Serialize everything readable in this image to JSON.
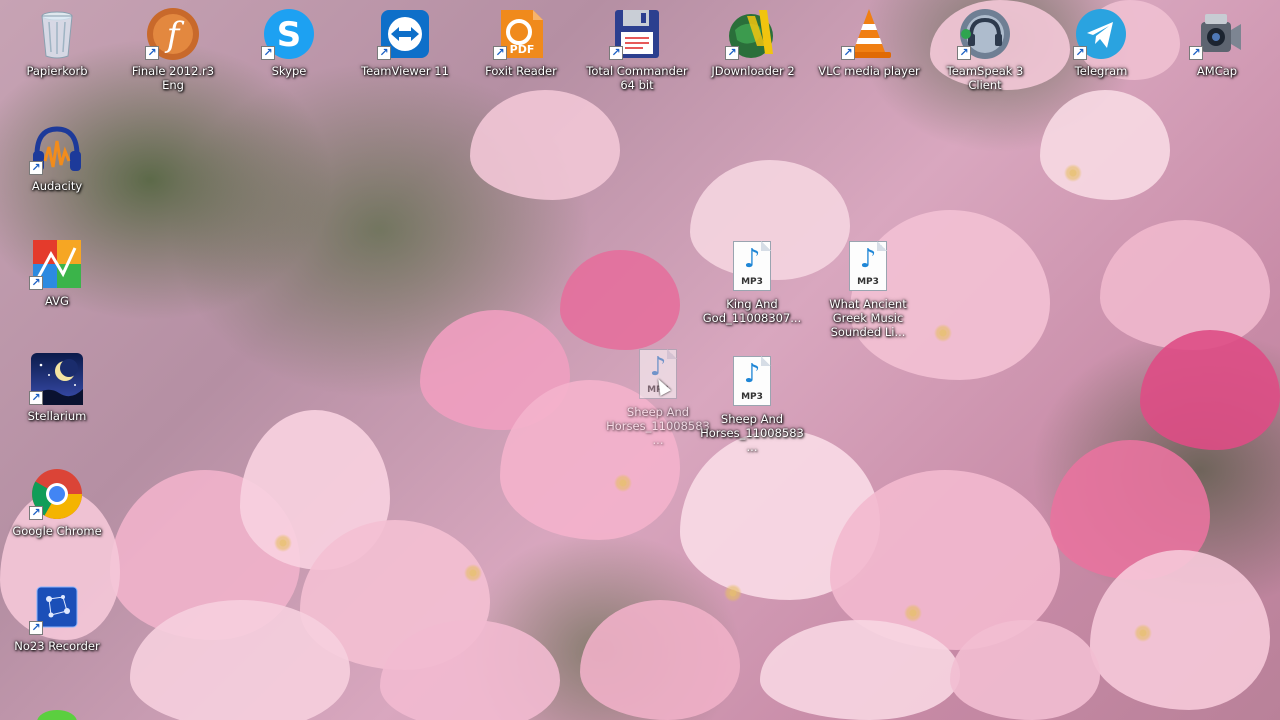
{
  "desktop": {
    "icons": [
      {
        "label": "Papierkorb",
        "icon": "recycle-bin-icon"
      },
      {
        "label": "Finale 2012.r3 Eng",
        "icon": "finale-icon"
      },
      {
        "label": "Skype",
        "icon": "skype-icon"
      },
      {
        "label": "TeamViewer 11",
        "icon": "teamviewer-icon"
      },
      {
        "label": "Foxit Reader",
        "icon": "foxit-reader-icon"
      },
      {
        "label": "Total Commander 64 bit",
        "icon": "floppy-disk-icon"
      },
      {
        "label": "JDownloader 2",
        "icon": "jdownloader-icon"
      },
      {
        "label": "VLC media player",
        "icon": "vlc-cone-icon"
      },
      {
        "label": "TeamSpeak 3 Client",
        "icon": "teamspeak-icon"
      },
      {
        "label": "Telegram",
        "icon": "telegram-icon"
      },
      {
        "label": "AMCap",
        "icon": "camcorder-icon"
      },
      {
        "label": "Audacity",
        "icon": "audacity-headphones-icon"
      },
      {
        "label": "AVG",
        "icon": "avg-icon"
      },
      {
        "label": "Stellarium",
        "icon": "stellarium-moon-icon"
      },
      {
        "label": "Google Chrome",
        "icon": "chrome-icon"
      },
      {
        "label": "No23 Recorder",
        "icon": "recorder-icon"
      }
    ],
    "files": [
      {
        "label": "King And God_11008307...",
        "type": "MP3"
      },
      {
        "label": "What Ancient Greek Music Sounded Li...",
        "type": "MP3"
      },
      {
        "label": "Sheep And Horses_11008583...",
        "type": "MP3"
      },
      {
        "label": "Sheep And Horses_11008583...",
        "type": "MP3"
      }
    ]
  },
  "colors": {
    "skype": "#1da1f2",
    "teamviewer": "#0e6fc9",
    "foxit": "#f08a1c",
    "vlc": "#f07f13",
    "telegram": "#2aa3e0",
    "finale": "#c8692b",
    "mp3_note": "#1f86d6"
  }
}
